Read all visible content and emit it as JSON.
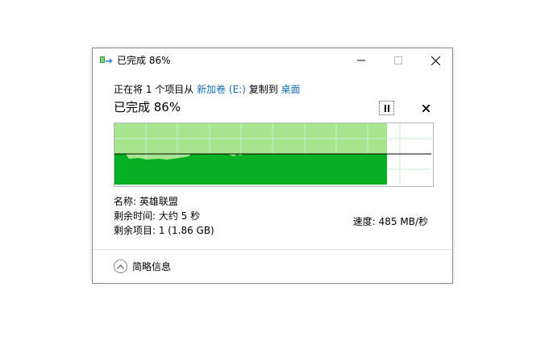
{
  "window": {
    "title": "已完成 86%",
    "icon": "file-copy-icon",
    "minimize_icon": "minimize-icon",
    "maximize_icon": "maximize-icon",
    "close_icon": "close-icon"
  },
  "copy_info": {
    "prefix": "正在将 1 个项目从 ",
    "source": "新加卷 (E:)",
    "middle": " 复制到 ",
    "destination": "桌面"
  },
  "progress": {
    "heading": "已完成 86%",
    "percent": 86,
    "speed_text": "速度: 485 MB/秒"
  },
  "details": {
    "name_line": "名称: 英雄联盟",
    "time_line": "剩余时间: 大约 5 秒",
    "items_line": "剩余项目: 1 (1.86 GB)"
  },
  "footer": {
    "toggle_label": "简略信息",
    "toggle_icon": "chevron-up-icon"
  },
  "colors": {
    "accent": "#1a6fb5",
    "graph_fill": "#06b025",
    "graph_progress": "#a6e48e",
    "graph_grid": "#cdeccd"
  }
}
